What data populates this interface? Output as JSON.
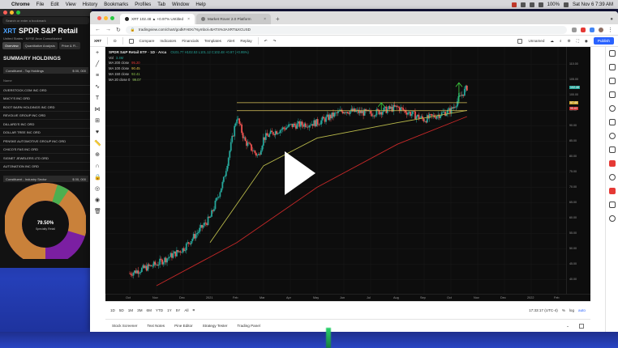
{
  "menubar": {
    "app": "Chrome",
    "items": [
      "File",
      "Edit",
      "View",
      "History",
      "Bookmarks",
      "Profiles",
      "Tab",
      "Window",
      "Help"
    ],
    "battery": "100%",
    "clock": "Sat Nov 6 7:39 AM"
  },
  "backwindow": {
    "url": "Search or enter a bookmark",
    "ticker": "XRT",
    "title": "SPDR S&P Retail",
    "subtitle": "United States · NYSE Arca Consolidated",
    "tabs": [
      "Overview",
      "Quantitative Analysis",
      "Price & Fl..."
    ],
    "section": "SUMMARY HOLDINGS",
    "select_label": "Constituent - Top Holdings",
    "select_right": "$ 00, 000",
    "column": "Name",
    "holdings": [
      "OVERSTOCK.COM INC ORD",
      "MACY'S INC ORD",
      "BOOT BARN HOLDINGS INC ORD",
      "REVOLVE GROUP INC ORD",
      "DILLARD'S INC ORD",
      "DOLLAR TREE INC ORD",
      "PENSKE AUTOMOTIVE GROUP INC ORD",
      "CHICO'S FAS INC ORD",
      "SIGNET JEWELERS LTD ORD",
      "AUTONATION INC ORD"
    ],
    "select2_label": "Constituent - Industry Sector",
    "select2_right": "$ 00, 000",
    "donut_value": "79.50%",
    "donut_caption": "Specialty Retail",
    "donut_share": 0.795
  },
  "browser": {
    "tabs": [
      {
        "label": "XRT 102.48 ▲ +0.97% Untitled",
        "active": true
      },
      {
        "label": "Market Rover 2.0 Platform",
        "active": false
      }
    ],
    "new_tab": "+",
    "url": "tradingview.com/chart/godkFAEK/?symbol=BATS%3AXRT&XCUSD"
  },
  "tvbar": {
    "symbol": "XRT",
    "interval": "D",
    "items": [
      "Compare",
      "Indicators",
      "Financials",
      "Templates",
      "Alert",
      "Replay"
    ],
    "layout": "Unnamed",
    "publish": "Publish"
  },
  "chart_legend": {
    "title": "SPDR S&P Retail ETF · 1D · Arca",
    "ohlc": "O101.77 H102.53 L101.12 C102.48 +0.97 (+0.95%)",
    "vol_label": "Vol",
    "vol_value": "3.4M",
    "mas": [
      {
        "label": "MA 200 close",
        "value": "95.20",
        "color": "#e53935"
      },
      {
        "label": "MA 100 close",
        "value": "90.45",
        "color": "#e0c24a"
      },
      {
        "label": "MA 150 close",
        "value": "92.41",
        "color": "#8bc34a"
      },
      {
        "label": "MA 20 close 0",
        "value": "99.07",
        "color": "#9ccc65"
      }
    ]
  },
  "price_labels": {
    "current": "102.48",
    "upper": "97.49",
    "lower": "95.63"
  },
  "chart_data": {
    "type": "candlestick",
    "x_labels": [
      "Oct",
      "Nov",
      "Dec",
      "2021",
      "Feb",
      "Mar",
      "Apr",
      "May",
      "Jun",
      "Jul",
      "Aug",
      "Sep",
      "Oct",
      "Nov",
      "Dec",
      "2022",
      "Feb"
    ],
    "y_ticks": [
      110,
      105,
      100,
      95,
      90,
      85,
      80,
      75,
      70,
      65,
      60,
      55,
      50,
      45,
      40
    ],
    "ylim": [
      38,
      113
    ],
    "close_path": [
      {
        "t": 0,
        "v": 42
      },
      {
        "t": 1,
        "v": 45
      },
      {
        "t": 2,
        "v": 50
      },
      {
        "t": 3,
        "v": 60
      },
      {
        "t": 3.5,
        "v": 72
      },
      {
        "t": 4,
        "v": 93
      },
      {
        "t": 4.3,
        "v": 85
      },
      {
        "t": 4.8,
        "v": 80
      },
      {
        "t": 5,
        "v": 86
      },
      {
        "t": 5.4,
        "v": 88
      },
      {
        "t": 6,
        "v": 90
      },
      {
        "t": 7,
        "v": 91
      },
      {
        "t": 8,
        "v": 95
      },
      {
        "t": 9,
        "v": 94
      },
      {
        "t": 10,
        "v": 96
      },
      {
        "t": 11,
        "v": 92
      },
      {
        "t": 12,
        "v": 95
      },
      {
        "t": 12.6,
        "v": 102.48
      }
    ],
    "resistance": 97.5,
    "support": 94.9,
    "ma200": [
      [
        1,
        38
      ],
      [
        4,
        52
      ],
      [
        7,
        70
      ],
      [
        10,
        84
      ],
      [
        12.6,
        93
      ]
    ],
    "ma100": [
      [
        3,
        52
      ],
      [
        5,
        77
      ],
      [
        7,
        86
      ],
      [
        10,
        91
      ],
      [
        12.6,
        95
      ]
    ],
    "range_buttons": [
      "1D",
      "5D",
      "1M",
      "3M",
      "6M",
      "YTD",
      "1Y",
      "5Y",
      "All"
    ],
    "time_display": "17:33:17 (UTC-4)",
    "scale_opts": [
      "%",
      "log",
      "auto"
    ]
  },
  "bottom_tabs": [
    "Stock Screener",
    "Text Notes",
    "Pine Editor",
    "Strategy Tester",
    "Trading Panel"
  ],
  "colors": {
    "up": "#26a69a",
    "down": "#ef5350",
    "ma200": "#c62828",
    "ma100": "#b8b84a",
    "trendline": "#d9c35a",
    "arrow": "#3ecf3e",
    "brand": "#2962ff"
  }
}
